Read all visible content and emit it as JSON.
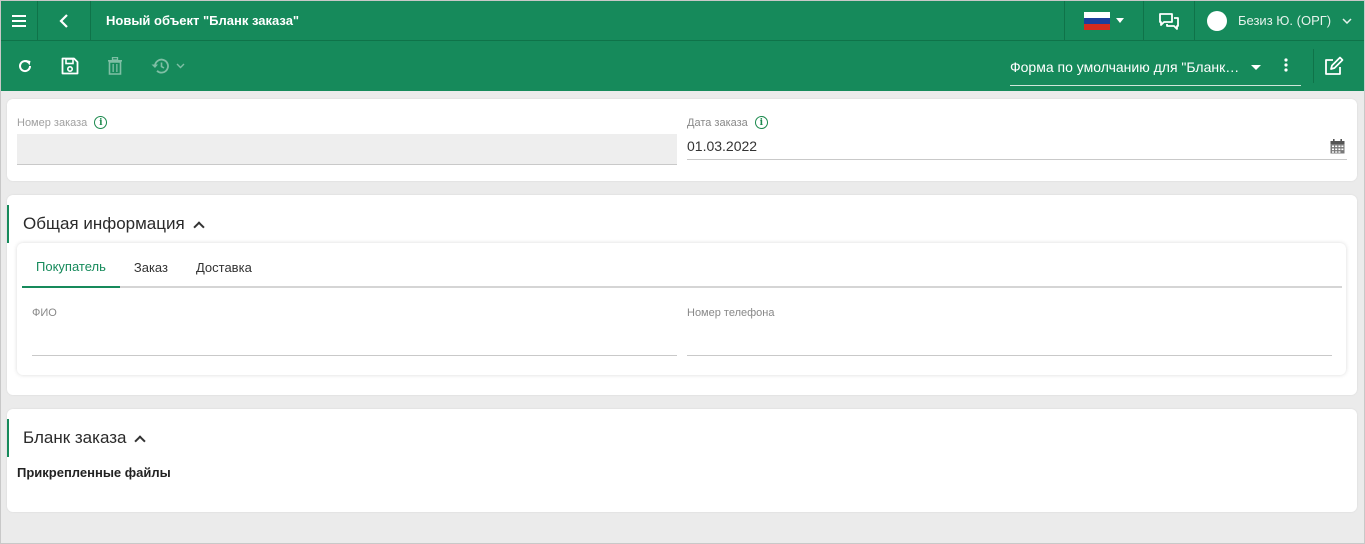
{
  "header": {
    "title": "Новый объект \"Бланк заказа\"",
    "user_name": "Безиз Ю. (ОРГ)",
    "flag_colors": [
      "#ffffff",
      "#1c3f9c",
      "#d52b1e"
    ]
  },
  "toolbar": {
    "form_selector": "Форма по умолчанию для \"Бланк заказа\""
  },
  "order": {
    "number_label": "Номер заказа",
    "number_value": "",
    "date_label": "Дата заказа",
    "date_value": "01.03.2022"
  },
  "general": {
    "title": "Общая информация",
    "tabs": [
      "Покупатель",
      "Заказ",
      "Доставка"
    ],
    "active_tab": "Покупатель",
    "fio_label": "ФИО",
    "phone_label": "Номер телефона"
  },
  "blank": {
    "title": "Бланк заказа",
    "attachments_label": "Прикрепленные файлы"
  },
  "colors": {
    "accent": "#168a5b",
    "background": "#ebebeb"
  }
}
